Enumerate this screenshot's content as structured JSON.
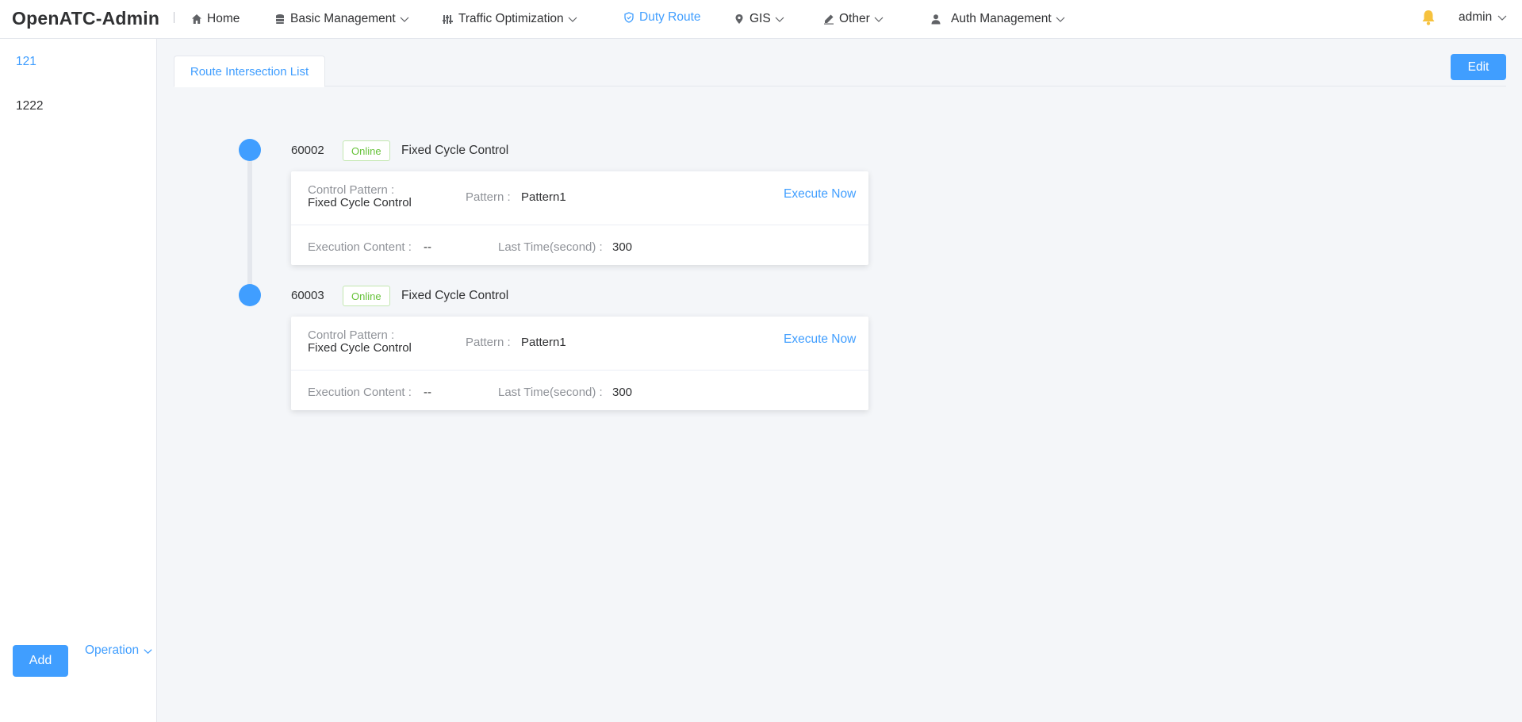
{
  "app": {
    "title": "OpenATC-Admin"
  },
  "nav": {
    "items": [
      {
        "label": "Home",
        "icon": "home-icon"
      },
      {
        "label": "Basic Management",
        "icon": "database-icon"
      },
      {
        "label": "Traffic Optimization",
        "icon": "sliders-icon"
      },
      {
        "label": "Duty Route",
        "icon": "shield-icon",
        "active": true
      },
      {
        "label": "GIS",
        "icon": "location-pin-icon"
      },
      {
        "label": "Other",
        "icon": "pencil-icon"
      },
      {
        "label": "Auth Management",
        "icon": "user-icon"
      }
    ],
    "user": "admin",
    "accent": "#409eff",
    "bell_color": "#f6c23e"
  },
  "sidebar": {
    "routes": [
      {
        "label": "121",
        "active": true
      },
      {
        "label": "1222",
        "active": false
      }
    ],
    "add_label": "Add",
    "operation_label": "Operation"
  },
  "main": {
    "tab_label": "Route Intersection List",
    "edit_label": "Edit",
    "intersections": [
      {
        "id": "60002",
        "status": "Online",
        "mode": "Fixed Cycle Control",
        "control_pattern_label": "Control Pattern :",
        "control_pattern_value": "Fixed Cycle Control",
        "pattern_label": "Pattern :",
        "pattern_value": "Pattern1",
        "execute_label": "Execute Now",
        "exec_content_label": "Execution Content :",
        "exec_content_value": "--",
        "last_time_label": "Last Time(second) :",
        "last_time_value": "300"
      },
      {
        "id": "60003",
        "status": "Online",
        "mode": "Fixed Cycle Control",
        "control_pattern_label": "Control Pattern :",
        "control_pattern_value": "Fixed Cycle Control",
        "pattern_label": "Pattern :",
        "pattern_value": "Pattern1",
        "execute_label": "Execute Now",
        "exec_content_label": "Execution Content :",
        "exec_content_value": "--",
        "last_time_label": "Last Time(second) :",
        "last_time_value": "300"
      }
    ]
  }
}
